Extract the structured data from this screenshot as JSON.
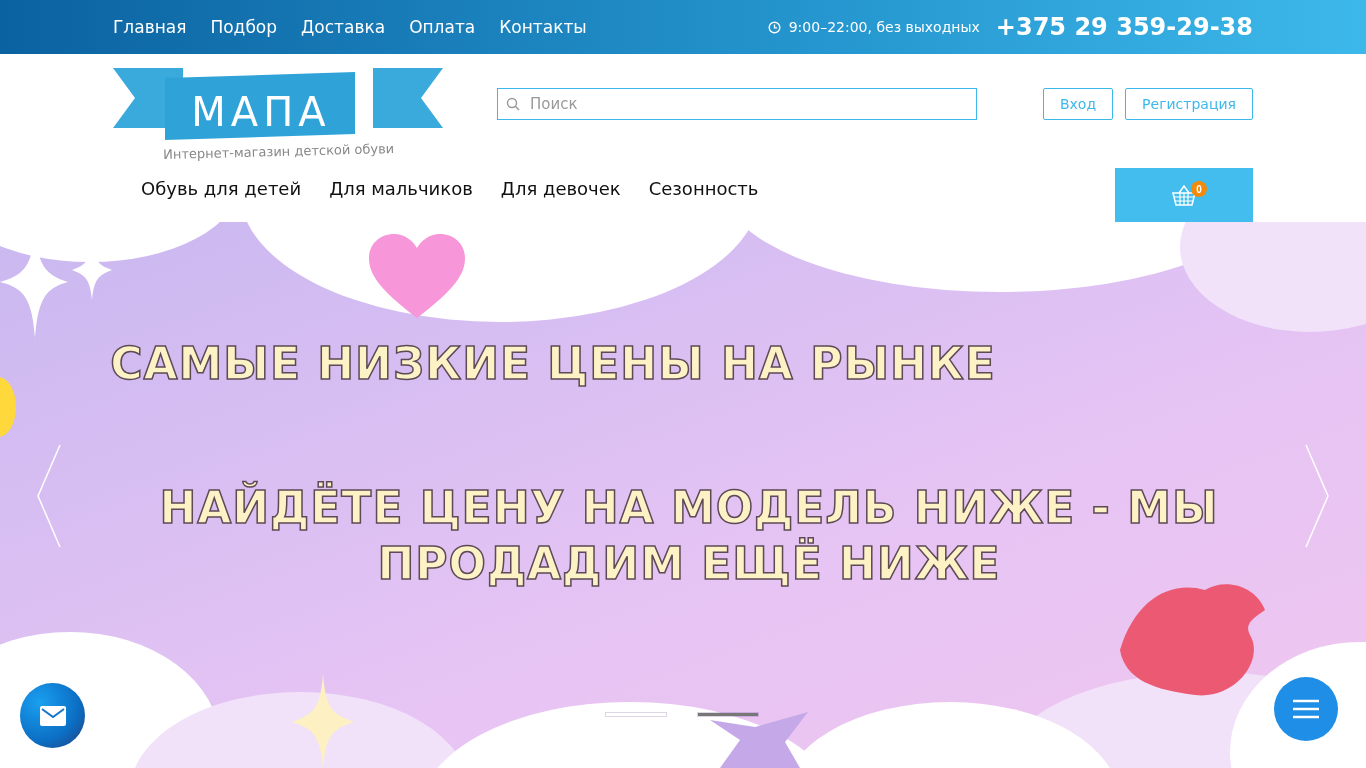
{
  "top_nav": [
    "Главная",
    "Подбор",
    "Доставка",
    "Оплата",
    "Контакты"
  ],
  "hours": "9:00–22:00, без выходных",
  "phone": "+375 29 359-29-38",
  "logo": {
    "name": "МАПА",
    "tagline": "Интернет-магазин детской обуви"
  },
  "search": {
    "placeholder": "Поиск"
  },
  "auth_buttons": [
    "Вход",
    "Регистрация"
  ],
  "categories": [
    "Обувь для детей",
    "Для мальчиков",
    "Для девочек",
    "Сезонность"
  ],
  "cart": {
    "count": "0"
  },
  "banner": {
    "headline": "САМЫЕ НИЗКИЕ ЦЕНЫ НА РЫНКЕ",
    "subline": "НАЙДЁТЕ ЦЕНУ НА МОДЕЛЬ НИЖЕ - МЫ ПРОДАДИМ ЕЩЁ НИЖЕ"
  },
  "slides": [
    {
      "selected": false
    },
    {
      "selected": true
    }
  ]
}
